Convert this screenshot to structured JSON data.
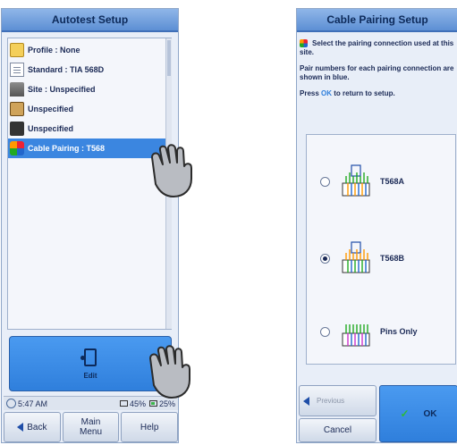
{
  "left_panel": {
    "title": "Autotest Setup",
    "items": [
      {
        "label": "Profile : None",
        "icon": "folder-icon"
      },
      {
        "label": "Standard : TIA 568D",
        "icon": "document-icon"
      },
      {
        "label": "Site : Unspecified",
        "icon": "building-icon"
      },
      {
        "label": "Unspecified",
        "icon": "cable-icon"
      },
      {
        "label": "Unspecified",
        "icon": "box-icon"
      },
      {
        "label": "Cable Pairing : T568",
        "icon": "cable-pairs-icon",
        "selected": true
      }
    ],
    "edit_label": "Edit",
    "status": {
      "time": "5:47 AM",
      "battery1": "45%",
      "battery2": "25%"
    },
    "nav": {
      "back": "Back",
      "main_menu": "Main Menu",
      "help": "Help"
    }
  },
  "right_panel": {
    "title": "Cable Pairing Setup",
    "instruction1": "Select the pairing connection used at this site.",
    "instruction2": "Pair numbers for each pairing connection are shown in blue.",
    "instruction3_pre": "Press",
    "instruction3_ok": "OK",
    "instruction3_post": "to return to setup.",
    "options": [
      {
        "label": "T568A",
        "checked": false
      },
      {
        "label": "T568B",
        "checked": true
      },
      {
        "label": "Pins Only",
        "checked": false
      }
    ],
    "previous": "Previous",
    "cancel": "Cancel",
    "ok": "OK"
  },
  "colors": {
    "accent_blue": "#3b86e0",
    "panel_bg": "#e8eef8",
    "title_gradient_top": "#8fb6e8"
  }
}
